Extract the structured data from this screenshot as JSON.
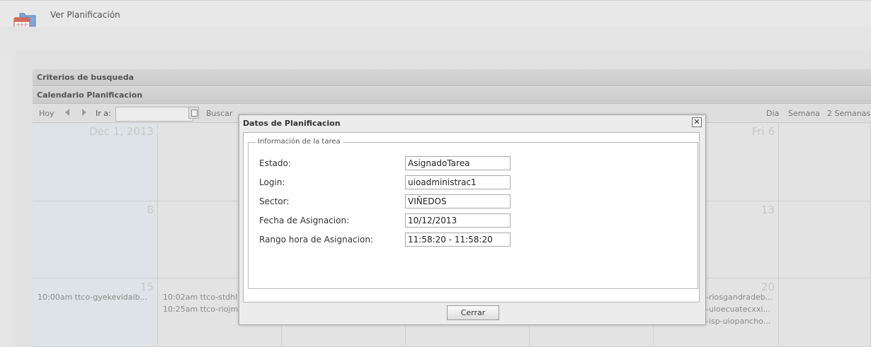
{
  "page": {
    "title": "Ver Planificación"
  },
  "panels": {
    "search_criteria": "Criterios de busqueda",
    "calendar_title": "Calendario Planificacion"
  },
  "toolbar": {
    "today": "Hoy",
    "goto_label": "Ir a:",
    "goto_value": "",
    "search": "Buscar",
    "views": [
      "Dia",
      "Semana",
      "2 Semanas"
    ]
  },
  "calendar": {
    "visible_day_labels": [
      "Dec 1, 2013",
      "Fri 6",
      "8",
      "13",
      "15",
      "20"
    ],
    "events": {
      "sun15": [
        "10:00am ttco-gyekevidalb..."
      ],
      "mon16": [
        "10:02am ttco-stdhl",
        "10:25am ttco-riojm"
      ],
      "fri20": [
        "-riosgandradeb...",
        "-uioecuatecxxi...",
        "-isp-uiopancho..."
      ]
    }
  },
  "dialog": {
    "title": "Datos de Planificacion",
    "section": "Información de la tarea",
    "fields": [
      {
        "label": "Estado:",
        "value": "AsignadoTarea"
      },
      {
        "label": "Login:",
        "value": "uioadministrac1"
      },
      {
        "label": "Sector:",
        "value": "VIÑEDOS"
      },
      {
        "label": "Fecha de Asignacion:",
        "value": "10/12/2013"
      },
      {
        "label": "Rango hora de Asignacion:",
        "value": "11:58:20 - 11:58:20"
      }
    ],
    "close_button": "Cerrar",
    "close_glyph": "✕"
  }
}
